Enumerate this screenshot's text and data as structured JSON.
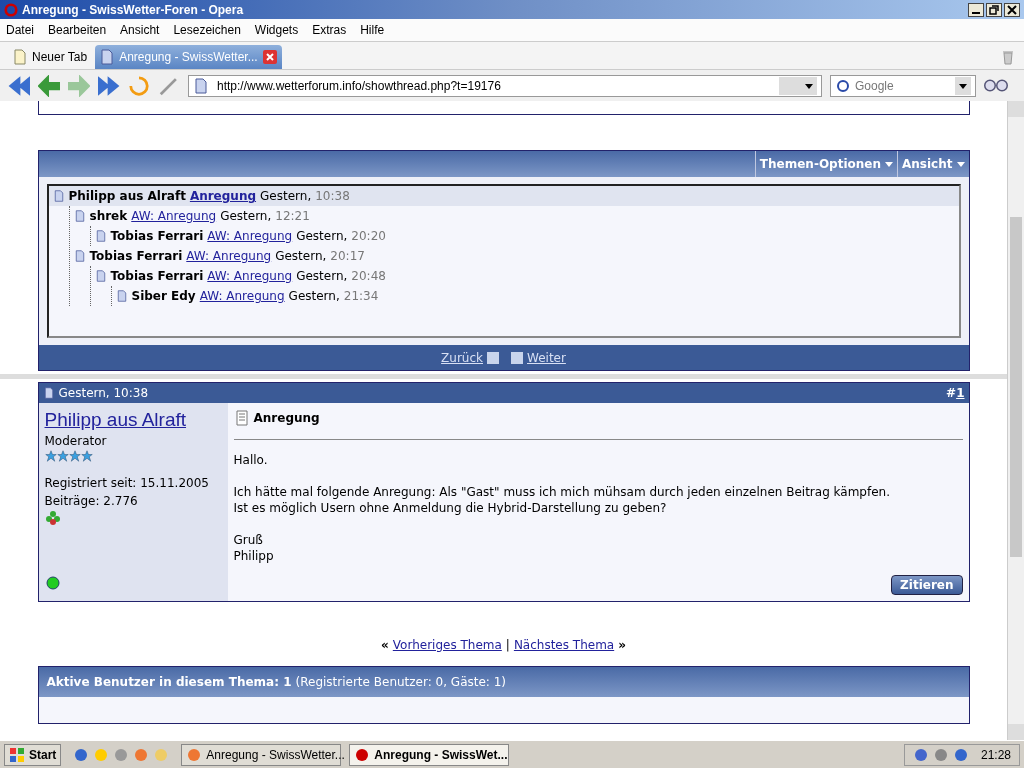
{
  "window": {
    "title": "Anregung - SwissWetter-Foren - Opera"
  },
  "menu": [
    "Datei",
    "Bearbeiten",
    "Ansicht",
    "Lesezeichen",
    "Widgets",
    "Extras",
    "Hilfe"
  ],
  "tabs": [
    {
      "label": "Neuer Tab",
      "selected": false,
      "kind": "new"
    },
    {
      "label": "Anregung - SwissWetter...",
      "selected": true,
      "kind": "page"
    }
  ],
  "address": {
    "value": "http://www.wetterforum.info/showthread.php?t=19176"
  },
  "search": {
    "placeholder": "Google"
  },
  "thread_box": {
    "options": [
      "Themen-Optionen",
      "Ansicht"
    ],
    "tree": [
      {
        "author": "Philipp aus Alraft",
        "title": "Anregung",
        "date": "Gestern,",
        "time": "10:38",
        "selected": true,
        "children": [
          {
            "author": "shrek",
            "title": "AW: Anregung",
            "date": "Gestern,",
            "time": "12:21",
            "selected": false,
            "children": [
              {
                "author": "Tobias Ferrari",
                "title": "AW: Anregung",
                "date": "Gestern,",
                "time": "20:20",
                "selected": false
              }
            ]
          },
          {
            "author": "Tobias Ferrari",
            "title": "AW: Anregung",
            "date": "Gestern,",
            "time": "20:17",
            "selected": false,
            "children": [
              {
                "author": "Tobias Ferrari",
                "title": "AW: Anregung",
                "date": "Gestern,",
                "time": "20:48",
                "selected": false,
                "children": [
                  {
                    "author": "Siber Edy",
                    "title": "AW: Anregung",
                    "date": "Gestern,",
                    "time": "21:34",
                    "selected": false
                  }
                ]
              }
            ]
          }
        ]
      }
    ],
    "nav": [
      "Zurück",
      "Weiter"
    ]
  },
  "post": {
    "date": "Gestern, 10:38",
    "number_prefix": "#",
    "number": "1",
    "author": "Philipp aus Alraft",
    "role": "Moderator",
    "stars": 4,
    "registered": "Registriert seit: 15.11.2005",
    "posts": "Beiträge: 2.776",
    "online": true,
    "title": "Anregung",
    "body": [
      "Hallo.",
      "Ich hätte mal folgende Anregung: Als \"Gast\" muss ich mich mühsam durch jeden einzelnen Beitrag kämpfen.\nIst es möglich Usern ohne Anmeldung die Hybrid-Darstellung zu geben?",
      "Gruß\nPhilipp"
    ],
    "quote_button": "Zitieren"
  },
  "thread_nav": {
    "prev_mark": "«",
    "prev": "Vorheriges Thema",
    "separator": "|",
    "next": "Nächstes Thema",
    "next_mark": "»"
  },
  "active_users": {
    "title": "Aktive Benutzer in diesem Thema: 1",
    "detail": "(Registrierte Benutzer: 0, Gäste: 1)"
  },
  "taskbar": {
    "start": "Start",
    "windows": [
      {
        "label": "Anregung - SwissWetter...",
        "selected": false
      },
      {
        "label": "Anregung - SwissWet...",
        "selected": true
      }
    ],
    "clock": "21:28"
  }
}
